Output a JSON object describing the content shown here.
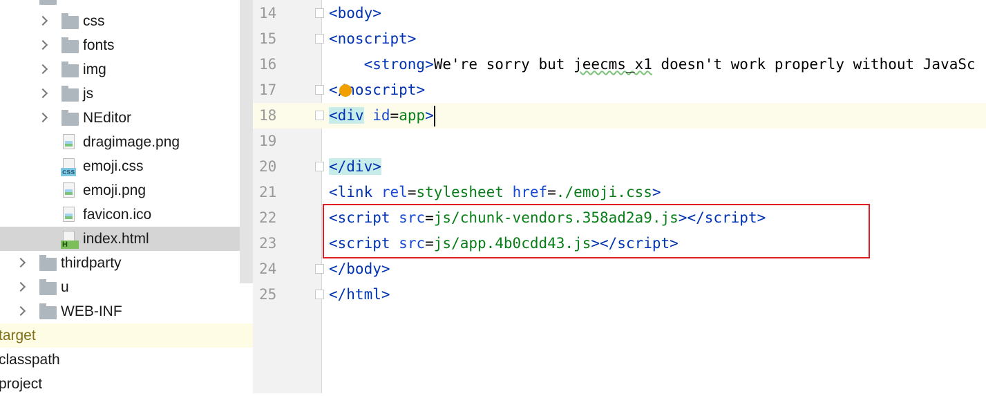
{
  "tree": {
    "items": [
      {
        "label": "css",
        "type": "folder",
        "expandable": true
      },
      {
        "label": "fonts",
        "type": "folder",
        "expandable": true
      },
      {
        "label": "img",
        "type": "folder",
        "expandable": true
      },
      {
        "label": "js",
        "type": "folder",
        "expandable": true
      },
      {
        "label": "NEditor",
        "type": "folder",
        "expandable": true
      },
      {
        "label": "dragimage.png",
        "type": "image"
      },
      {
        "label": "emoji.css",
        "type": "css",
        "badge": "css"
      },
      {
        "label": "emoji.png",
        "type": "image"
      },
      {
        "label": "favicon.ico",
        "type": "image"
      },
      {
        "label": "index.html",
        "type": "html",
        "badge": "H",
        "selected": true
      },
      {
        "label": "thirdparty",
        "type": "folder",
        "expandable": true
      },
      {
        "label": "u",
        "type": "folder",
        "expandable": true
      },
      {
        "label": "WEB-INF",
        "type": "folder",
        "expandable": true
      },
      {
        "label": "target",
        "type": "folder-excluded"
      },
      {
        "label": "classpath",
        "type": "file"
      },
      {
        "label": "project",
        "type": "file"
      }
    ]
  },
  "editor": {
    "current_line": 18,
    "lines": [
      {
        "n": "14",
        "text": "<body>"
      },
      {
        "n": "15",
        "text": "<noscript>"
      },
      {
        "n": "16",
        "text": "    <strong>We're sorry but jeecms_x1 doesn't work properly without JavaSc"
      },
      {
        "n": "17",
        "text": "</noscript>"
      },
      {
        "n": "18",
        "text": "<div id=app>"
      },
      {
        "n": "19",
        "text": ""
      },
      {
        "n": "20",
        "text": "</div>"
      },
      {
        "n": "21",
        "text": "<link rel=stylesheet href=./emoji.css>"
      },
      {
        "n": "22",
        "text": "<script src=js/chunk-vendors.358ad2a9.js></script>"
      },
      {
        "n": "23",
        "text": "<script src=js/app.4b0cdd43.js></script>"
      },
      {
        "n": "24",
        "text": "</body>"
      },
      {
        "n": "25",
        "text": "</html>"
      }
    ]
  },
  "colors": {
    "tag": "#0033b3",
    "attr_value": "#067d17",
    "highlight_box": "#e31b23",
    "selection": "#d5d5d5"
  }
}
